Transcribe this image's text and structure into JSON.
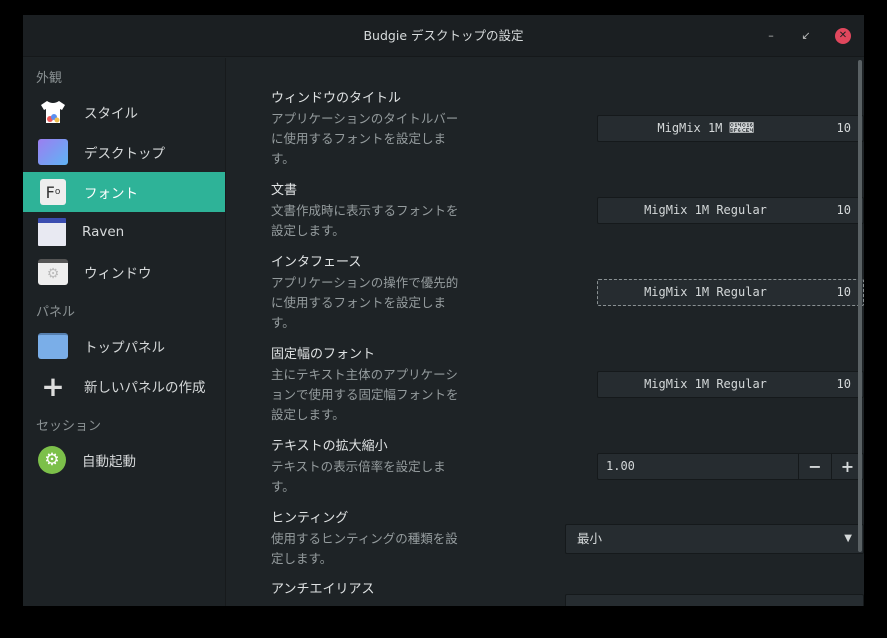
{
  "window": {
    "title": "Budgie デスクトップの設定",
    "minimize": "–",
    "restore": "↙",
    "close": "✕"
  },
  "sidebar": {
    "sections": [
      {
        "label": "外観"
      },
      {
        "label": "パネル"
      },
      {
        "label": "セッション"
      }
    ],
    "items": [
      {
        "label": "スタイル",
        "icon": "tshirt-icon"
      },
      {
        "label": "デスクトップ",
        "icon": "desktop-icon"
      },
      {
        "label": "フォント",
        "icon": "font-icon",
        "active": true
      },
      {
        "label": "Raven",
        "icon": "raven-icon"
      },
      {
        "label": "ウィンドウ",
        "icon": "window-icon"
      },
      {
        "label": "トップパネル",
        "icon": "panel-icon"
      },
      {
        "label": "新しいパネルの作成",
        "icon": "plus-icon"
      },
      {
        "label": "自動起動",
        "icon": "autostart-gear-icon"
      }
    ],
    "accent": "#2eb398"
  },
  "settings": [
    {
      "title": "ウィンドウのタイトル",
      "desc": "アプリケーションのタイトルバーに使用するフォントを設定します。",
      "font": "MigMix 1M 𔯶𖳤",
      "size": "10"
    },
    {
      "title": "文書",
      "desc": "文書作成時に表示するフォントを設定します。",
      "font": "MigMix 1M Regular",
      "size": "10"
    },
    {
      "title": "インタフェース",
      "desc": "アプリケーションの操作で優先的に使用するフォントを設定します。",
      "font": "MigMix 1M Regular",
      "size": "10"
    },
    {
      "title": "固定幅のフォント",
      "desc": "主にテキスト主体のアプリケーションで使用する固定幅フォントを設定します。",
      "font": "MigMix 1M Regular",
      "size": "10"
    }
  ],
  "scaling": {
    "title": "テキストの拡大縮小",
    "desc": "テキストの表示倍率を設定します。",
    "value": "1.00",
    "minus": "−",
    "plus": "+"
  },
  "hinting": {
    "title": "ヒンティング",
    "desc": "使用するヒンティングの種類を設定します。",
    "value": "最小"
  },
  "antialias": {
    "title": "アンチエイリアス"
  }
}
